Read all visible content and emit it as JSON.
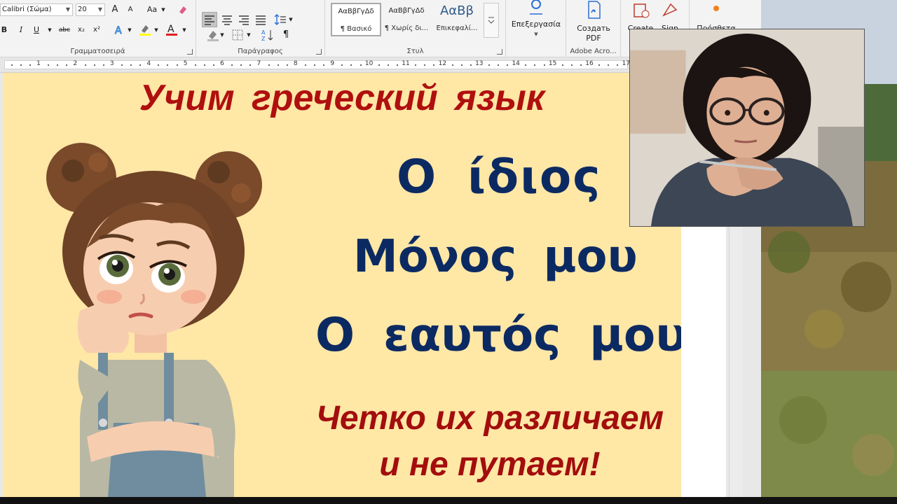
{
  "ribbon": {
    "font": {
      "family": "Calibri (Σώμα)",
      "size": "20",
      "grow_label": "A",
      "shrink_label": "A",
      "case_label": "Aa",
      "bold": "B",
      "italic": "I",
      "underline": "U",
      "strike": "abc",
      "subscript": "x₂",
      "superscript": "x²",
      "group_label": "Γραμματοσειρά"
    },
    "paragraph": {
      "group_label": "Παράγραφος",
      "pilcrow": "¶"
    },
    "styles": {
      "group_label": "Στυλ",
      "items": [
        {
          "sample": "ΑαΒβΓγΔδ",
          "name": "¶ Βασικό"
        },
        {
          "sample": "ΑαΒβΓγΔδ",
          "name": "¶ Χωρίς δι..."
        },
        {
          "sample": "ΑαΒβ",
          "name": "Επικεφαλί..."
        }
      ]
    },
    "editing": {
      "label": "Επεξεργασία"
    },
    "adobe": {
      "label_line1": "Создать",
      "label_line2": "PDF",
      "group_label": "Adobe Acro..."
    },
    "create": {
      "label": "Create"
    },
    "sign": {
      "label": "Sign"
    },
    "addin": {
      "label": "Πρόσθετα"
    }
  },
  "ruler": {
    "numbers": [
      "1",
      "2",
      "3",
      "4",
      "5",
      "6",
      "7",
      "8",
      "9",
      "10",
      "11",
      "12",
      "13",
      "14",
      "15",
      "16",
      "17"
    ]
  },
  "document": {
    "title": "Учим  греческий  язык",
    "greek_line1": "Ο ίδιος",
    "greek_line2": "Μόνος μου",
    "greek_line3": "Ο εαυτός μου",
    "subtitle_line1": "Четко их различаем",
    "subtitle_line2": "и не путаем!"
  },
  "colors": {
    "page_bg": "#ffe7a6",
    "title_red": "#b00f0f",
    "greek_navy": "#0c2a62"
  }
}
